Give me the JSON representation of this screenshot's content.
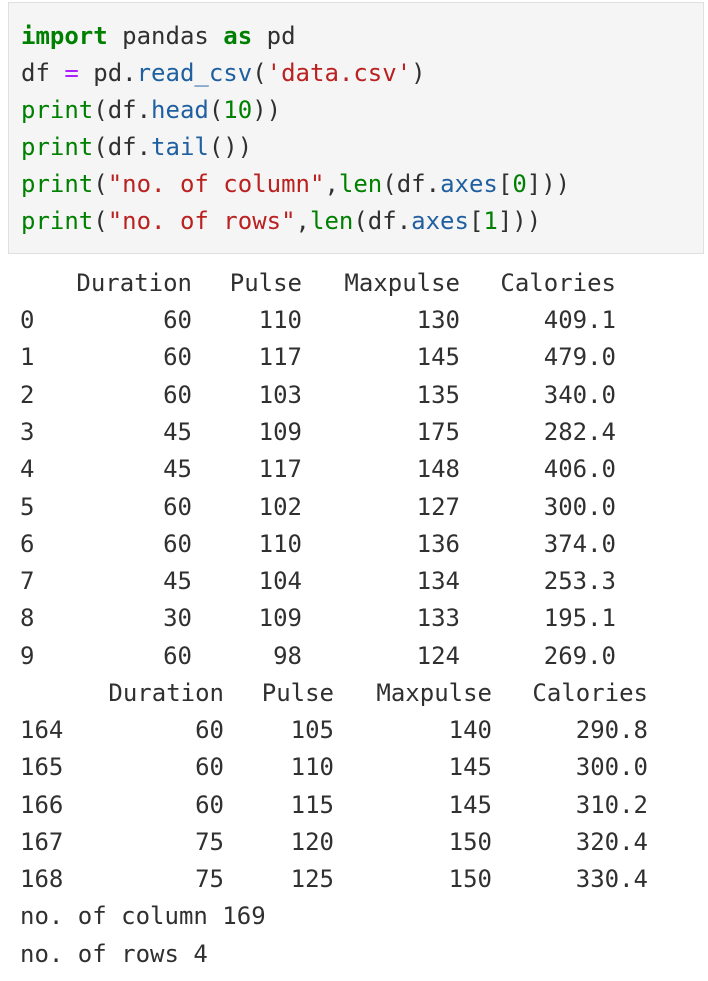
{
  "code": {
    "line1": {
      "kw1": "import",
      "mid": " pandas ",
      "kw2": "as",
      "end": " pd"
    },
    "line2": {
      "a": "df ",
      "eq": "=",
      "b": " pd.",
      "fn": "read_csv",
      "c": "(",
      "s": "'data.csv'",
      "d": ")"
    },
    "line3": {
      "fn": "print",
      "a": "(df.",
      "m": "head",
      "b": "(",
      "n": "10",
      "c": "))"
    },
    "line4": {
      "fn": "print",
      "a": "(df.",
      "m": "tail",
      "b": "())"
    },
    "line5": {
      "fn": "print",
      "a": "(",
      "s": "\"no. of column\"",
      "b": ",",
      "fn2": "len",
      "c": "(df.",
      "m": "axes",
      "d": "[",
      "n": "0",
      "e": "]))"
    },
    "line6": {
      "fn": "print",
      "a": "(",
      "s": "\"no. of rows\"",
      "b": ",",
      "fn2": "len",
      "c": "(df.",
      "m": "axes",
      "d": "[",
      "n": "1",
      "e": "]))"
    }
  },
  "head_table": {
    "columns": [
      "Duration",
      "Pulse",
      "Maxpulse",
      "Calories"
    ],
    "rows": [
      [
        "0",
        "60",
        "110",
        "130",
        "409.1"
      ],
      [
        "1",
        "60",
        "117",
        "145",
        "479.0"
      ],
      [
        "2",
        "60",
        "103",
        "135",
        "340.0"
      ],
      [
        "3",
        "45",
        "109",
        "175",
        "282.4"
      ],
      [
        "4",
        "45",
        "117",
        "148",
        "406.0"
      ],
      [
        "5",
        "60",
        "102",
        "127",
        "300.0"
      ],
      [
        "6",
        "60",
        "110",
        "136",
        "374.0"
      ],
      [
        "7",
        "45",
        "104",
        "134",
        "253.3"
      ],
      [
        "8",
        "30",
        "109",
        "133",
        "195.1"
      ],
      [
        "9",
        "60",
        "98",
        "124",
        "269.0"
      ]
    ]
  },
  "tail_table": {
    "columns": [
      "Duration",
      "Pulse",
      "Maxpulse",
      "Calories"
    ],
    "rows": [
      [
        "164",
        "60",
        "105",
        "140",
        "290.8"
      ],
      [
        "165",
        "60",
        "110",
        "145",
        "300.0"
      ],
      [
        "166",
        "60",
        "115",
        "145",
        "310.2"
      ],
      [
        "167",
        "75",
        "120",
        "150",
        "320.4"
      ],
      [
        "168",
        "75",
        "125",
        "150",
        "330.4"
      ]
    ]
  },
  "messages": {
    "columns_line": "no. of column 169",
    "rows_line": "no. of rows 4"
  }
}
